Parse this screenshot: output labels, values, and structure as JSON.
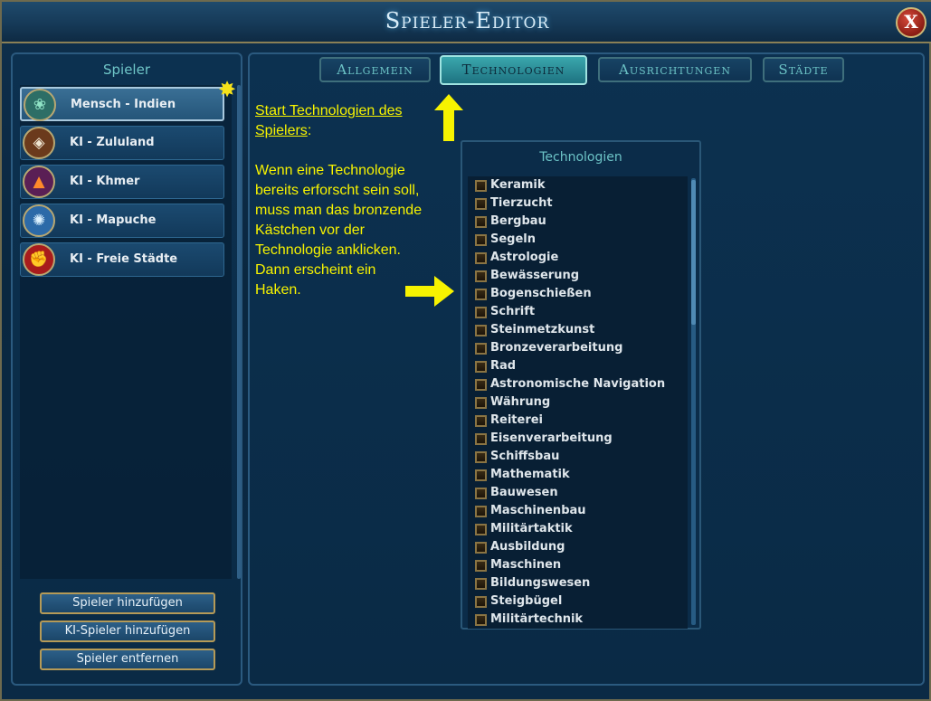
{
  "window": {
    "title": "Spieler-Editor",
    "close_label": "X"
  },
  "left_panel": {
    "header": "Spieler",
    "players": [
      {
        "label": "Mensch - Indien",
        "icon": "lotus-icon",
        "color": "#3a8a7d",
        "glyph": "❀"
      },
      {
        "label": "KI - Zululand",
        "icon": "shield-icon",
        "color": "#6b3a1c",
        "glyph": "◈"
      },
      {
        "label": "KI - Khmer",
        "icon": "temple-icon",
        "color": "#5a1f55",
        "glyph": "▲"
      },
      {
        "label": "KI - Mapuche",
        "icon": "spiral-icon",
        "color": "#2c6aa8",
        "glyph": "✺"
      },
      {
        "label": "KI - Freie Städte",
        "icon": "fist-icon",
        "color": "#b32020",
        "glyph": "✊"
      }
    ],
    "buttons": {
      "add_player": "Spieler hinzufügen",
      "add_ai_player": "KI-Spieler hinzufügen",
      "remove_player": "Spieler entfernen"
    }
  },
  "tabs": [
    {
      "label": "Allgemein",
      "active": false
    },
    {
      "label": "Technologien",
      "active": true
    },
    {
      "label": "Ausrichtungen",
      "active": false
    },
    {
      "label": "Städte",
      "active": false
    }
  ],
  "annotation": {
    "title_part1": "Start Technologien des Spielers",
    "title_suffix": ":",
    "body": "Wenn eine Technologie bereits erforscht sein soll, muss man das bronzende Kästchen vor der Technologie anklicken. Dann erscheint ein Haken."
  },
  "tech_panel": {
    "header": "Technologien",
    "items": [
      "Keramik",
      "Tierzucht",
      "Bergbau",
      "Segeln",
      "Astrologie",
      "Bewässerung",
      "Bogenschießen",
      "Schrift",
      "Steinmetzkunst",
      "Bronzeverarbeitung",
      "Rad",
      "Astronomische Navigation",
      "Währung",
      "Reiterei",
      "Eisenverarbeitung",
      "Schiffsbau",
      "Mathematik",
      "Bauwesen",
      "Maschinenbau",
      "Militärtaktik",
      "Ausbildung",
      "Maschinen",
      "Bildungswesen",
      "Steigbügel",
      "Militärtechnik"
    ]
  }
}
